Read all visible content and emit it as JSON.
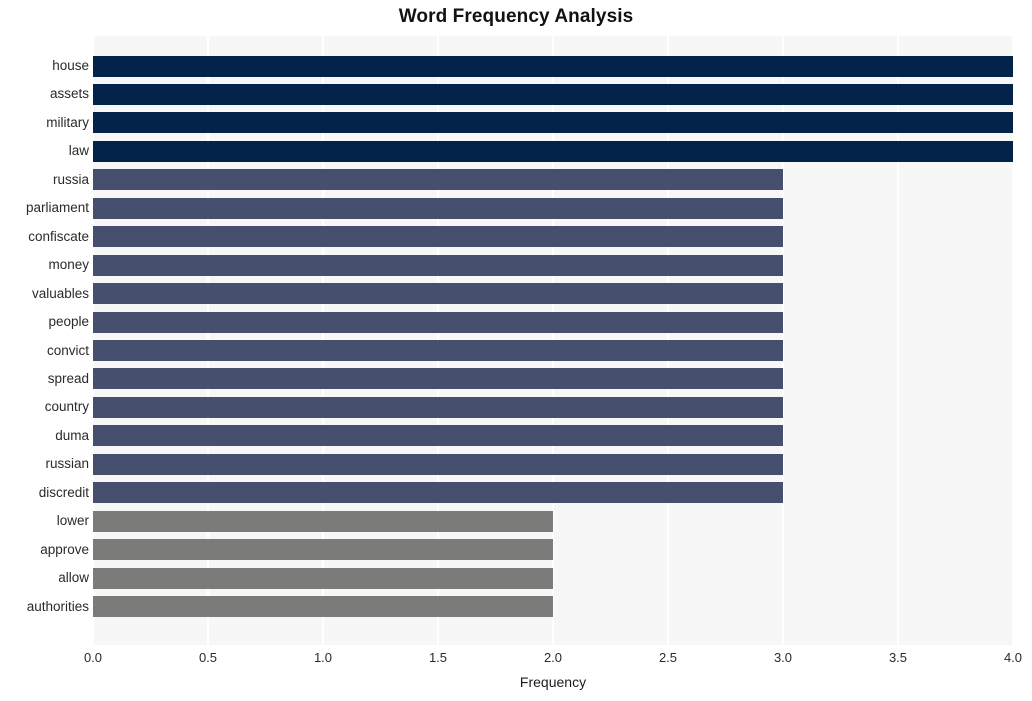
{
  "chart_data": {
    "type": "bar",
    "orientation": "horizontal",
    "title": "Word Frequency Analysis",
    "xlabel": "Frequency",
    "ylabel": "",
    "xlim": [
      0.0,
      4.0
    ],
    "xticks": [
      "0.0",
      "0.5",
      "1.0",
      "1.5",
      "2.0",
      "2.5",
      "3.0",
      "3.5",
      "4.0"
    ],
    "xtick_values": [
      0.0,
      0.5,
      1.0,
      1.5,
      2.0,
      2.5,
      3.0,
      3.5,
      4.0
    ],
    "grid": true,
    "legend": false,
    "categories": [
      "house",
      "assets",
      "military",
      "law",
      "russia",
      "parliament",
      "confiscate",
      "money",
      "valuables",
      "people",
      "convict",
      "spread",
      "country",
      "duma",
      "russian",
      "discredit",
      "lower",
      "approve",
      "allow",
      "authorities"
    ],
    "values": [
      4,
      4,
      4,
      4,
      3,
      3,
      3,
      3,
      3,
      3,
      3,
      3,
      3,
      3,
      3,
      3,
      2,
      2,
      2,
      2
    ],
    "bar_colors": [
      "#03234b",
      "#03234b",
      "#03234b",
      "#03234b",
      "#474f6e",
      "#474f6e",
      "#474f6e",
      "#474f6e",
      "#474f6e",
      "#474f6e",
      "#474f6e",
      "#474f6e",
      "#474f6e",
      "#474f6e",
      "#474f6e",
      "#474f6e",
      "#7b7b79",
      "#7b7b79",
      "#7b7b79",
      "#7b7b79"
    ],
    "palette": {
      "high": "#03234b",
      "mid": "#474f6e",
      "low": "#7b7b79",
      "plot_background": "#f7f7f8",
      "figure_background": "#ffffff",
      "gridline": "#ffffff"
    }
  }
}
